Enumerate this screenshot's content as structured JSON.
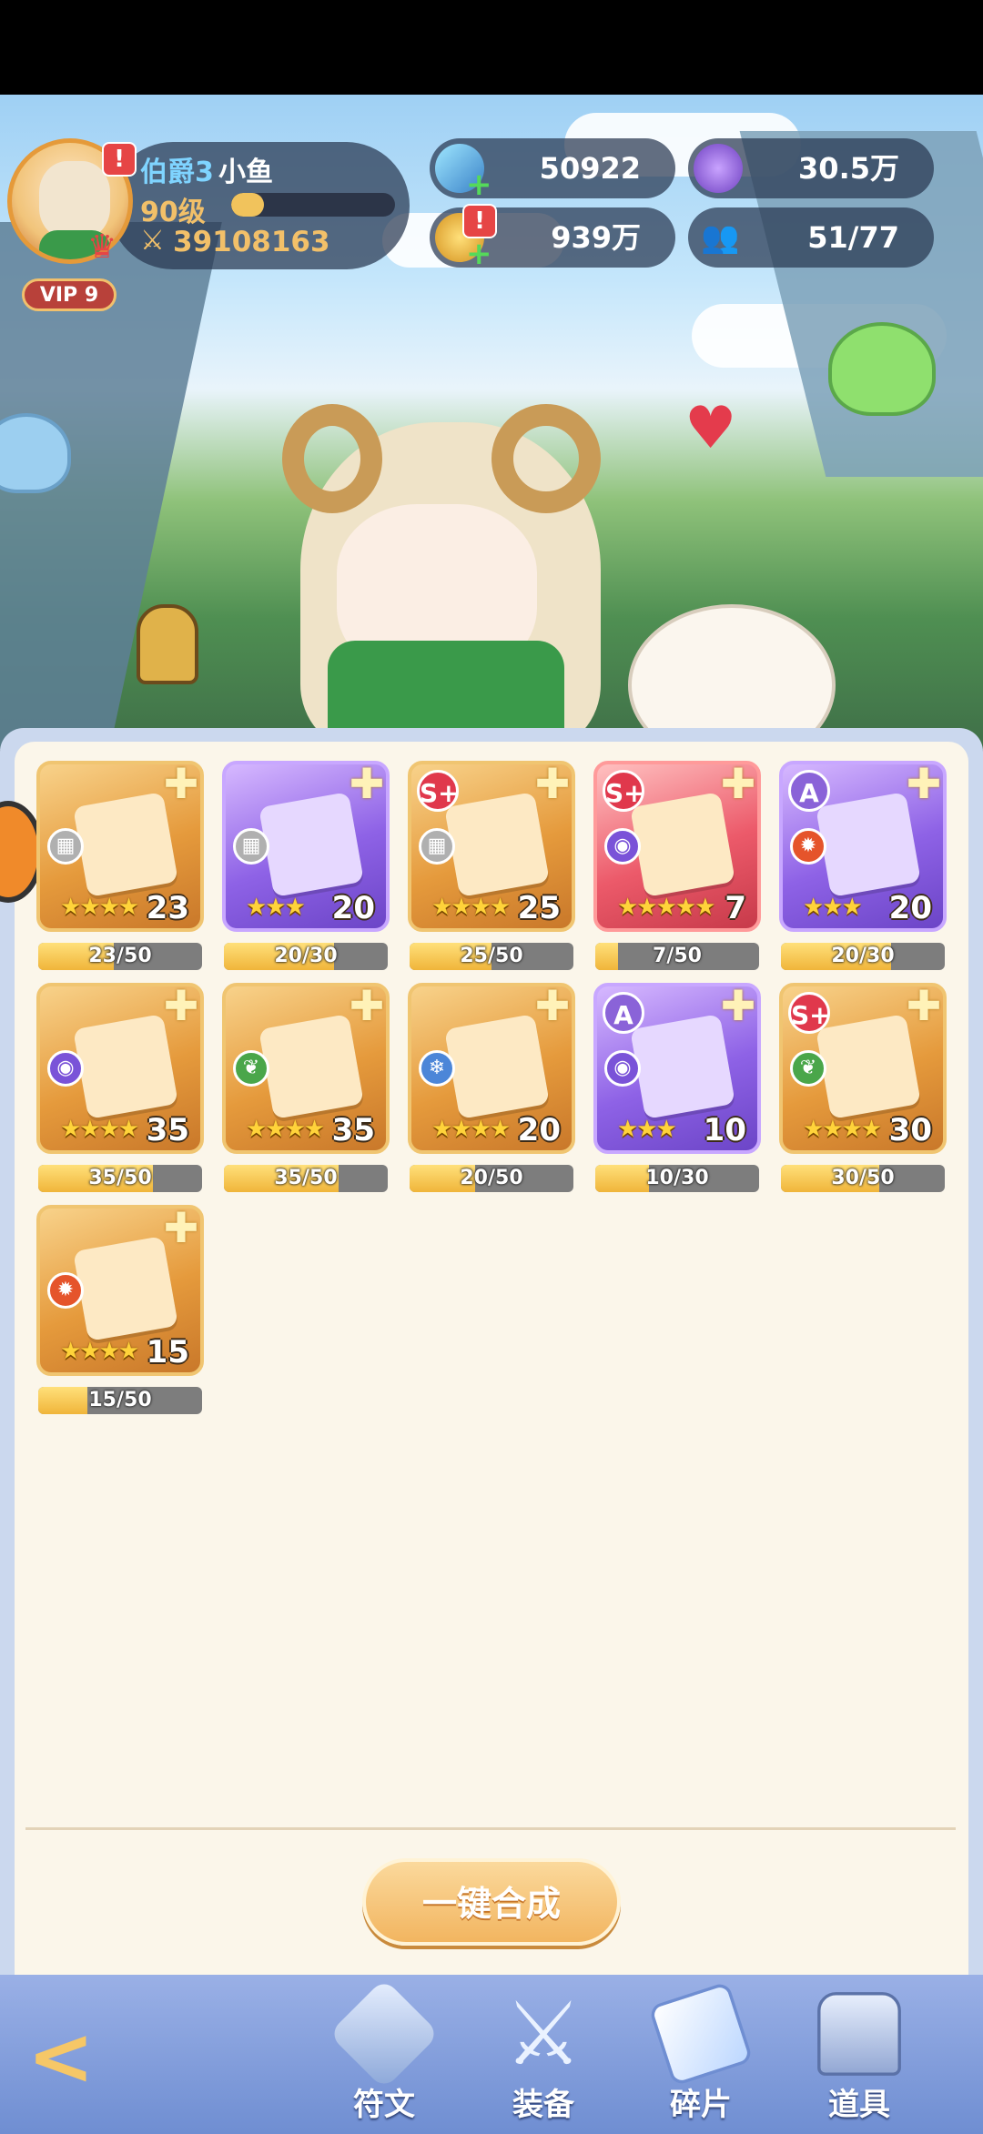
{
  "player": {
    "title": "伯爵3",
    "name": "小鱼",
    "level": "90级",
    "level_progress": 0.2,
    "power": "39108163",
    "vip": "VIP 9"
  },
  "currencies": {
    "star_gem": "50922",
    "purple_token": "30.5万",
    "gold": "939万",
    "friends": "51/77"
  },
  "fragments": [
    {
      "rarity": "gold",
      "rank": "",
      "element": "grid",
      "stars": 4,
      "count": "23",
      "progress": "23/50",
      "fill": 0.46
    },
    {
      "rarity": "purple",
      "rank": "",
      "element": "grid",
      "stars": 3,
      "count": "20",
      "progress": "20/30",
      "fill": 0.67
    },
    {
      "rarity": "gold",
      "rank": "S+",
      "element": "grid",
      "stars": 4,
      "count": "25",
      "progress": "25/50",
      "fill": 0.5
    },
    {
      "rarity": "red",
      "rank": "S+",
      "element": "eye",
      "stars": 5,
      "count": "7",
      "progress": "7/50",
      "fill": 0.14
    },
    {
      "rarity": "purple",
      "rank": "A",
      "element": "fire",
      "stars": 3,
      "count": "20",
      "progress": "20/30",
      "fill": 0.67
    },
    {
      "rarity": "gold",
      "rank": "",
      "element": "eye",
      "stars": 4,
      "count": "35",
      "progress": "35/50",
      "fill": 0.7
    },
    {
      "rarity": "gold",
      "rank": "",
      "element": "leaf",
      "stars": 4,
      "count": "35",
      "progress": "35/50",
      "fill": 0.7
    },
    {
      "rarity": "gold",
      "rank": "",
      "element": "ice",
      "stars": 4,
      "count": "20",
      "progress": "20/50",
      "fill": 0.4
    },
    {
      "rarity": "purple",
      "rank": "A",
      "element": "eye",
      "stars": 3,
      "count": "10",
      "progress": "10/30",
      "fill": 0.33
    },
    {
      "rarity": "gold",
      "rank": "S+",
      "element": "leaf",
      "stars": 4,
      "count": "30",
      "progress": "30/50",
      "fill": 0.6
    },
    {
      "rarity": "gold",
      "rank": "",
      "element": "fire",
      "stars": 4,
      "count": "15",
      "progress": "15/50",
      "fill": 0.3
    }
  ],
  "actions": {
    "merge_all": "一键合成"
  },
  "nav": [
    {
      "label": "符文",
      "icon": "rune-icon"
    },
    {
      "label": "装备",
      "icon": "crossed-swords-icon"
    },
    {
      "label": "碎片",
      "icon": "puzzle-icon"
    },
    {
      "label": "道具",
      "icon": "chest-icon"
    }
  ]
}
